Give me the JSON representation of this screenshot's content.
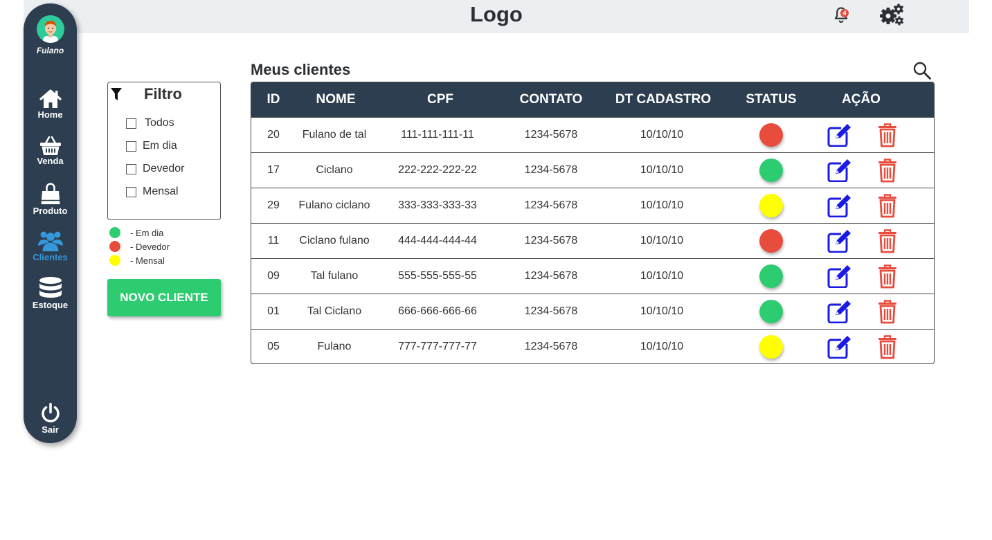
{
  "header": {
    "logo": "Logo",
    "notification_count": "4"
  },
  "sidebar": {
    "username": "Fulano",
    "items": [
      {
        "label": "Home",
        "icon": "home-icon"
      },
      {
        "label": "Venda",
        "icon": "basket-icon"
      },
      {
        "label": "Produto",
        "icon": "shopping-bag-icon"
      },
      {
        "label": "Clientes",
        "icon": "users-icon",
        "active": true
      },
      {
        "label": "Estoque",
        "icon": "database-icon"
      }
    ],
    "logout_label": "Sair"
  },
  "filter": {
    "title": "Filtro",
    "options": [
      "Todos",
      "Em dia",
      "Devedor",
      "Mensal"
    ]
  },
  "legend": [
    {
      "label": "- Em dia",
      "color": "#2ecc71"
    },
    {
      "label": "- Devedor",
      "color": "#e74c3c"
    },
    {
      "label": "- Mensal",
      "color": "#ffff00"
    }
  ],
  "new_client_label": "NOVO CLIENTE",
  "main": {
    "title": "Meus clientes",
    "columns": [
      "ID",
      "NOME",
      "CPF",
      "CONTATO",
      "DT CADASTRO",
      "STATUS",
      "AÇÃO"
    ],
    "rows": [
      {
        "id": "20",
        "nome": "Fulano de tal",
        "cpf": "111-111-111-11",
        "contato": "1234-5678",
        "dt": "10/10/10",
        "status": "Devedor"
      },
      {
        "id": "17",
        "nome": "Ciclano",
        "cpf": "222-222-222-22",
        "contato": "1234-5678",
        "dt": "10/10/10",
        "status": "Em dia"
      },
      {
        "id": "29",
        "nome": "Fulano ciclano",
        "cpf": "333-333-333-33",
        "contato": "1234-5678",
        "dt": "10/10/10",
        "status": "Mensal"
      },
      {
        "id": "11",
        "nome": "Ciclano fulano",
        "cpf": "444-444-444-44",
        "contato": "1234-5678",
        "dt": "10/10/10",
        "status": "Devedor"
      },
      {
        "id": "09",
        "nome": "Tal fulano",
        "cpf": "555-555-555-55",
        "contato": "1234-5678",
        "dt": "10/10/10",
        "status": "Em dia"
      },
      {
        "id": "01",
        "nome": "Tal Ciclano",
        "cpf": "666-666-666-66",
        "contato": "1234-5678",
        "dt": "10/10/10",
        "status": "Em dia"
      },
      {
        "id": "05",
        "nome": "Fulano",
        "cpf": "777-777-777-77",
        "contato": "1234-5678",
        "dt": "10/10/10",
        "status": "Mensal"
      }
    ]
  },
  "colors": {
    "sidebar": "#2c3e50",
    "accent": "#3498db",
    "em_dia": "#2ecc71",
    "devedor": "#e74c3c",
    "mensal": "#ffff00",
    "edit": "#1a1ae6",
    "delete": "#e74c3c"
  }
}
